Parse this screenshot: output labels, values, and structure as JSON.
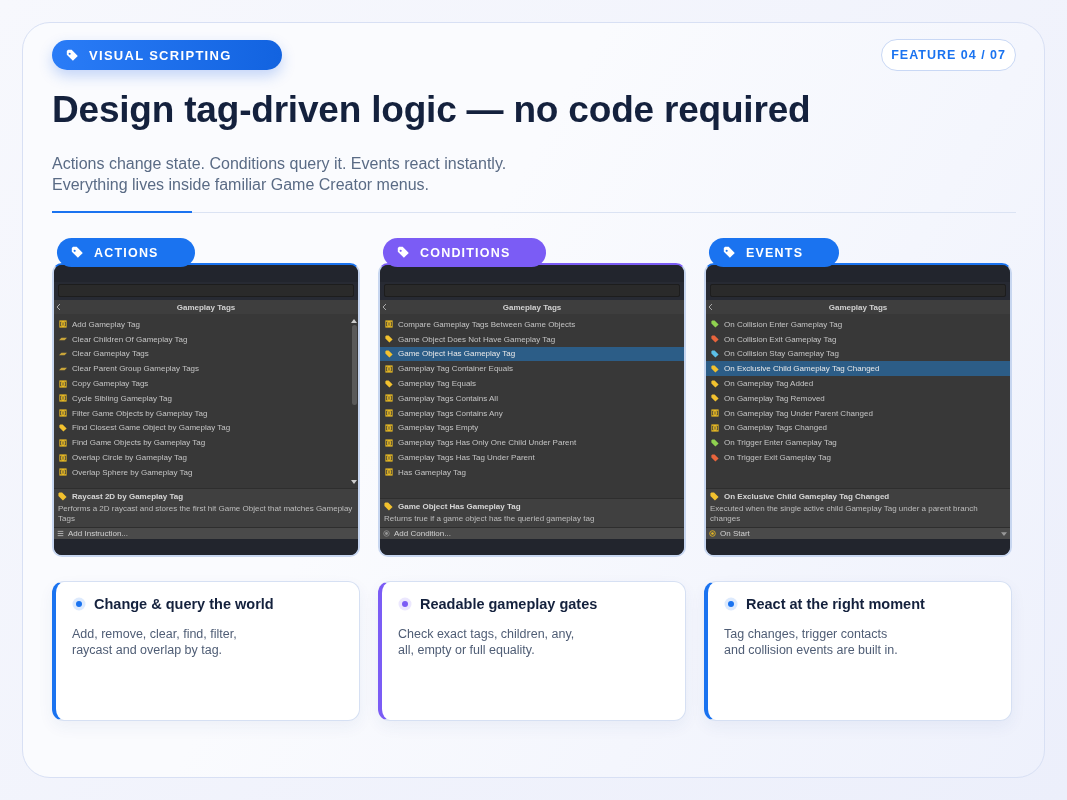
{
  "badge": {
    "label": "VISUAL SCRIPTING"
  },
  "counter": "FEATURE 04 / 07",
  "title": "Design tag-driven logic — no code required",
  "subtitle": [
    "Actions change state. Conditions query it. Events react instantly.",
    "Everything lives inside familiar Game Creator menus."
  ],
  "columns": [
    {
      "tag": "ACTIONS",
      "color": "#1a73f0",
      "panel": {
        "header": "Gameplay Tags",
        "scrollbar": true,
        "items": [
          {
            "label": "Add Gameplay Tag",
            "kind": "component",
            "selected": false
          },
          {
            "label": "Clear Children Of Gameplay Tag",
            "kind": "clear",
            "selected": false
          },
          {
            "label": "Clear Gameplay Tags",
            "kind": "clear",
            "selected": false
          },
          {
            "label": "Clear Parent Group Gameplay Tags",
            "kind": "clear",
            "selected": false
          },
          {
            "label": "Copy Gameplay Tags",
            "kind": "component",
            "selected": false
          },
          {
            "label": "Cycle Sibling Gameplay Tag",
            "kind": "component",
            "selected": false
          },
          {
            "label": "Filter Game Objects by Gameplay Tag",
            "kind": "component",
            "selected": false
          },
          {
            "label": "Find Closest Game Object by Gameplay Tag",
            "kind": "tag",
            "color": "#f2c12e",
            "selected": false
          },
          {
            "label": "Find Game Objects by Gameplay Tag",
            "kind": "component",
            "selected": false
          },
          {
            "label": "Overlap Circle by Gameplay Tag",
            "kind": "component",
            "selected": false
          },
          {
            "label": "Overlap Sphere by Gameplay Tag",
            "kind": "component",
            "selected": false
          }
        ],
        "info": {
          "title": "Raycast 2D by Gameplay Tag",
          "text": "Performs a 2D raycast and stores the first hit Game Object that matches Gameplay Tags"
        },
        "footer": {
          "kind": "menu",
          "label": "Add Instruction..."
        }
      },
      "card": {
        "title": "Change & query the world",
        "text": "Add, remove, clear, find, filter, raycast and overlap by tag."
      }
    },
    {
      "tag": "CONDITIONS",
      "color": "#7b5cf5",
      "panel": {
        "header": "Gameplay Tags",
        "scrollbar": false,
        "items": [
          {
            "label": "Compare Gameplay Tags Between Game Objects",
            "kind": "component",
            "selected": false
          },
          {
            "label": "Game Object Does Not Have Gameplay Tag",
            "kind": "tag",
            "color": "#f2c12e",
            "selected": false
          },
          {
            "label": "Game Object Has Gameplay Tag",
            "kind": "tag",
            "color": "#f2c12e",
            "selected": true
          },
          {
            "label": "Gameplay Tag Container Equals",
            "kind": "component",
            "selected": false
          },
          {
            "label": "Gameplay Tag Equals",
            "kind": "tag",
            "color": "#f2c12e",
            "selected": false
          },
          {
            "label": "Gameplay Tags Contains All",
            "kind": "component",
            "selected": false
          },
          {
            "label": "Gameplay Tags Contains Any",
            "kind": "component",
            "selected": false
          },
          {
            "label": "Gameplay Tags Empty",
            "kind": "component",
            "selected": false
          },
          {
            "label": "Gameplay Tags Has Only One Child Under Parent",
            "kind": "component",
            "selected": false
          },
          {
            "label": "Gameplay Tags Has Tag Under Parent",
            "kind": "component",
            "selected": false
          },
          {
            "label": "Has Gameplay Tag",
            "kind": "component",
            "selected": false
          }
        ],
        "info": {
          "title": "Game Object Has Gameplay Tag",
          "text": "Returns true if a game object has the queried gameplay tag"
        },
        "footer": {
          "kind": "add",
          "label": "Add Condition..."
        }
      },
      "card": {
        "title": "Readable gameplay gates",
        "text": "Check exact tags, children, any, all, empty or full equality."
      }
    },
    {
      "tag": "EVENTS",
      "color": "#1a73f0",
      "panel": {
        "header": "Gameplay Tags",
        "scrollbar": false,
        "items": [
          {
            "label": "On Collision Enter Gameplay Tag",
            "kind": "tag",
            "color": "#8fd14f",
            "selected": false
          },
          {
            "label": "On Collision Exit Gameplay Tag",
            "kind": "tag",
            "color": "#e8643c",
            "selected": false
          },
          {
            "label": "On Collision Stay Gameplay Tag",
            "kind": "tag",
            "color": "#5bc0e8",
            "selected": false
          },
          {
            "label": "On Exclusive Child Gameplay Tag Changed",
            "kind": "tag",
            "color": "#f2c12e",
            "selected": true
          },
          {
            "label": "On Gameplay Tag Added",
            "kind": "tag",
            "color": "#f2c12e",
            "selected": false
          },
          {
            "label": "On Gameplay Tag Removed",
            "kind": "tag",
            "color": "#f2c12e",
            "selected": false
          },
          {
            "label": "On Gameplay Tag Under Parent Changed",
            "kind": "component",
            "selected": false
          },
          {
            "label": "On Gameplay Tags Changed",
            "kind": "component",
            "selected": false
          },
          {
            "label": "On Trigger Enter Gameplay Tag",
            "kind": "tag",
            "color": "#8fd14f",
            "selected": false
          },
          {
            "label": "On Trigger Exit Gameplay Tag",
            "kind": "tag",
            "color": "#e8643c",
            "selected": false
          }
        ],
        "info": {
          "title": "On Exclusive Child Gameplay Tag Changed",
          "text": "Executed when the single active child Gameplay Tag under a parent branch changes"
        },
        "footer": {
          "kind": "dropdown",
          "label": "On Start"
        }
      },
      "card": {
        "title": "React at the right moment",
        "text": "Tag changes, trigger contacts and collision events are built in."
      }
    }
  ]
}
